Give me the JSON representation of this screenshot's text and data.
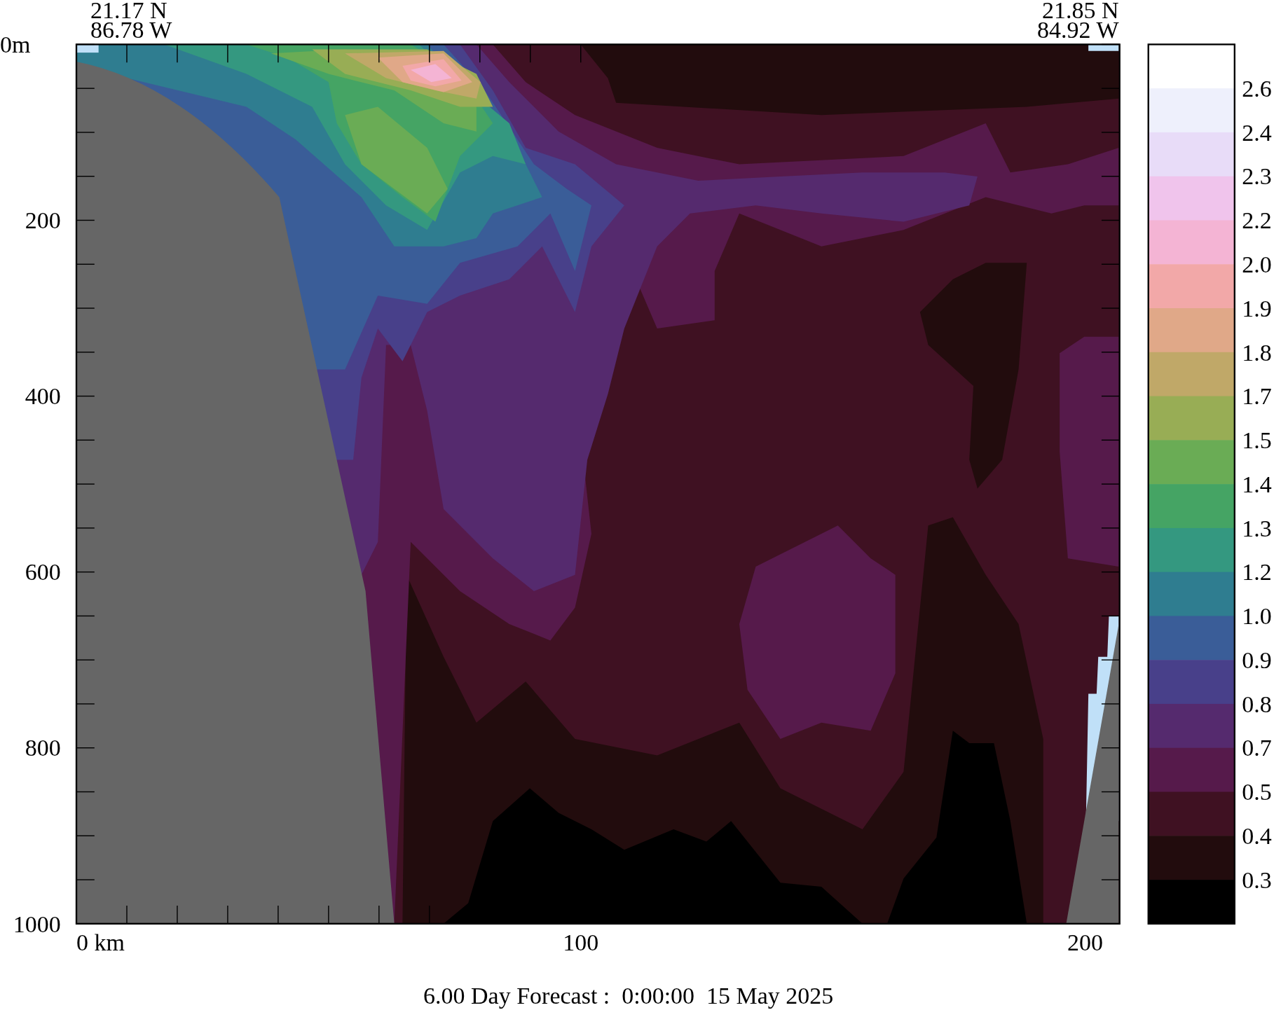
{
  "header": {
    "start": {
      "lat": "21.17 N",
      "lon": "86.78 W"
    },
    "end": {
      "lat": "21.85 N",
      "lon": "84.92 W"
    }
  },
  "y_axis": {
    "labels": [
      "0m",
      "200",
      "400",
      "600",
      "800",
      "1000"
    ]
  },
  "x_axis": {
    "labels": [
      "0 km",
      "100",
      "200"
    ]
  },
  "colorbar": {
    "bands": [
      {
        "color": "#eef0fc"
      },
      {
        "color": "#e8dcf8"
      },
      {
        "color": "#f0c4ec"
      },
      {
        "color": "#f4b4d4"
      },
      {
        "color": "#f2a8a8"
      },
      {
        "color": "#e0a888"
      },
      {
        "color": "#c0a868"
      },
      {
        "color": "#98ad55"
      },
      {
        "color": "#6aac55"
      },
      {
        "color": "#45a464"
      },
      {
        "color": "#349880"
      },
      {
        "color": "#2f7d90"
      },
      {
        "color": "#3a5d98"
      },
      {
        "color": "#48408a"
      },
      {
        "color": "#552a6e"
      },
      {
        "color": "#561a4b"
      },
      {
        "color": "#3f1122"
      },
      {
        "color": "#220c0d"
      },
      {
        "color": "#000000"
      }
    ],
    "labels": [
      "2.6",
      "2.4",
      "2.3",
      "2.2",
      "2.0",
      "1.9",
      "1.8",
      "1.7",
      "1.5",
      "1.4",
      "1.3",
      "1.2",
      "1.0",
      "0.9",
      "0.8",
      "0.7",
      "0.5",
      "0.4",
      "0.3"
    ]
  },
  "caption": "6.00 Day Forecast :  0:00:00  15 May 2025"
}
